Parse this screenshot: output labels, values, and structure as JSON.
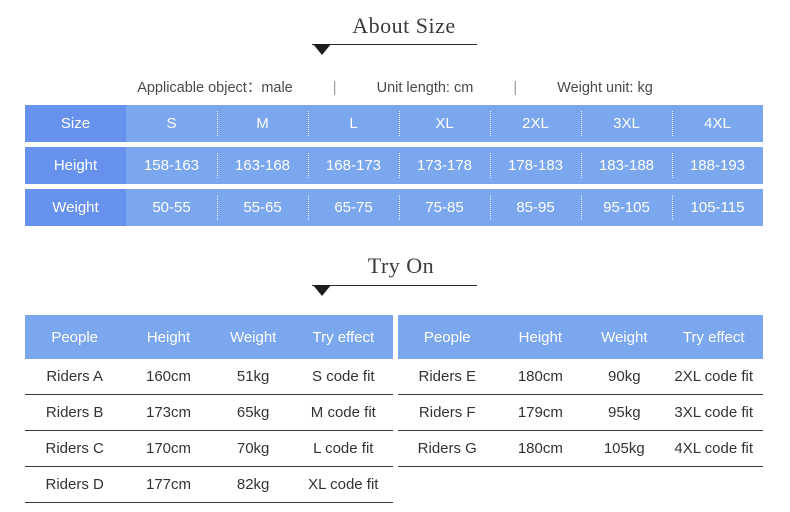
{
  "about_size": {
    "title": "About Size",
    "meta": {
      "applicable_object": "Applicable object：male",
      "unit_length": "Unit length: cm",
      "weight_unit": "Weight unit: kg",
      "separator": "|"
    },
    "table": {
      "row_labels": [
        "Size",
        "Height",
        "Weight"
      ],
      "sizes": [
        "S",
        "M",
        "L",
        "XL",
        "2XL",
        "3XL",
        "4XL"
      ],
      "height": [
        "158-163",
        "163-168",
        "168-173",
        "173-178",
        "178-183",
        "183-188",
        "188-193"
      ],
      "weight": [
        "50-55",
        "55-65",
        "65-75",
        "75-85",
        "85-95",
        "95-105",
        "105-115"
      ]
    }
  },
  "try_on": {
    "title": "Try On",
    "columns": [
      "People",
      "Height",
      "Weight",
      "Try effect"
    ],
    "left_rows": [
      {
        "people": "Riders A",
        "height": "160cm",
        "weight": "51kg",
        "effect": "S code fit"
      },
      {
        "people": "Riders B",
        "height": "173cm",
        "weight": "65kg",
        "effect": "M code fit"
      },
      {
        "people": "Riders C",
        "height": "170cm",
        "weight": "70kg",
        "effect": "L code fit"
      },
      {
        "people": "Riders D",
        "height": "177cm",
        "weight": "82kg",
        "effect": "XL code fit"
      }
    ],
    "right_rows": [
      {
        "people": "Riders E",
        "height": "180cm",
        "weight": "90kg",
        "effect": "2XL code fit"
      },
      {
        "people": "Riders F",
        "height": "179cm",
        "weight": "95kg",
        "effect": "3XL code fit"
      },
      {
        "people": "Riders G",
        "height": "180cm",
        "weight": "105kg",
        "effect": "4XL code fit"
      }
    ]
  },
  "colors": {
    "header_blue_dark": "#6691ec",
    "cell_blue_light": "#7aa7ee",
    "text_dark": "#333333",
    "rule_dark": "#2b2b2b"
  }
}
